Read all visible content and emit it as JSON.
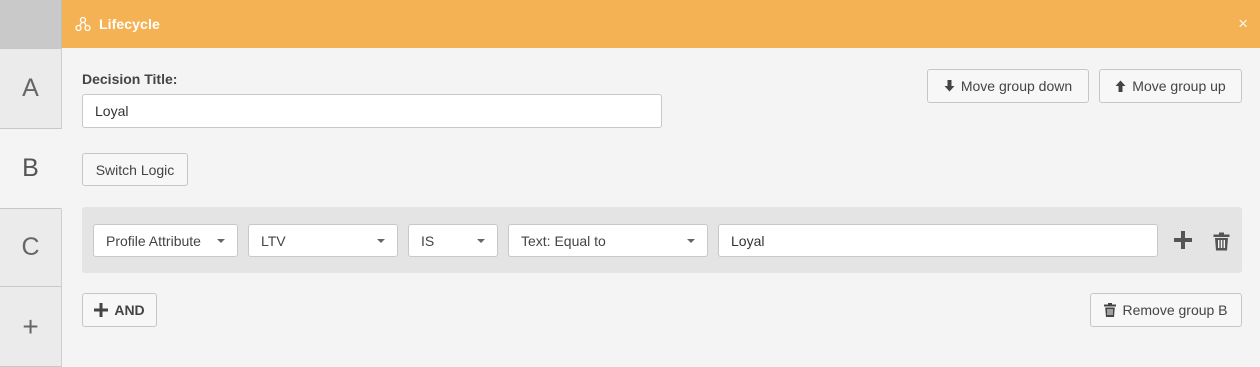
{
  "header": {
    "title": "Lifecycle",
    "close": "×",
    "icon": "hierarchy-icon"
  },
  "tabs": [
    {
      "label": "A",
      "active": false
    },
    {
      "label": "B",
      "active": true
    },
    {
      "label": "C",
      "active": false
    },
    {
      "label": "+",
      "active": false
    }
  ],
  "decision": {
    "label": "Decision Title:",
    "value": "Loyal"
  },
  "buttons": {
    "move_down": "Move group down",
    "move_up": "Move group up",
    "switch_logic": "Switch Logic",
    "and": "AND",
    "remove_group": "Remove group B"
  },
  "rule": {
    "type": "Profile Attribute",
    "attribute": "LTV",
    "operator": "IS",
    "comparison": "Text: Equal to",
    "value": "Loyal"
  },
  "colors": {
    "header": "#f4b254",
    "accent_text": "#ffffff"
  }
}
